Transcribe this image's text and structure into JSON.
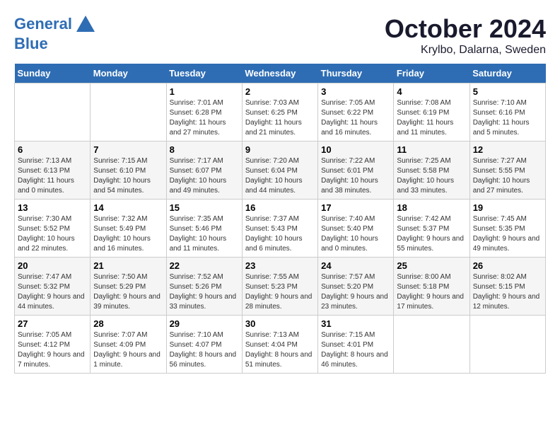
{
  "header": {
    "logo_line1": "General",
    "logo_line2": "Blue",
    "month_title": "October 2024",
    "location": "Krylbo, Dalarna, Sweden"
  },
  "days_of_week": [
    "Sunday",
    "Monday",
    "Tuesday",
    "Wednesday",
    "Thursday",
    "Friday",
    "Saturday"
  ],
  "weeks": [
    [
      {
        "day": "",
        "info": ""
      },
      {
        "day": "",
        "info": ""
      },
      {
        "day": "1",
        "info": "Sunrise: 7:01 AM\nSunset: 6:28 PM\nDaylight: 11 hours and 27 minutes."
      },
      {
        "day": "2",
        "info": "Sunrise: 7:03 AM\nSunset: 6:25 PM\nDaylight: 11 hours and 21 minutes."
      },
      {
        "day": "3",
        "info": "Sunrise: 7:05 AM\nSunset: 6:22 PM\nDaylight: 11 hours and 16 minutes."
      },
      {
        "day": "4",
        "info": "Sunrise: 7:08 AM\nSunset: 6:19 PM\nDaylight: 11 hours and 11 minutes."
      },
      {
        "day": "5",
        "info": "Sunrise: 7:10 AM\nSunset: 6:16 PM\nDaylight: 11 hours and 5 minutes."
      }
    ],
    [
      {
        "day": "6",
        "info": "Sunrise: 7:13 AM\nSunset: 6:13 PM\nDaylight: 11 hours and 0 minutes."
      },
      {
        "day": "7",
        "info": "Sunrise: 7:15 AM\nSunset: 6:10 PM\nDaylight: 10 hours and 54 minutes."
      },
      {
        "day": "8",
        "info": "Sunrise: 7:17 AM\nSunset: 6:07 PM\nDaylight: 10 hours and 49 minutes."
      },
      {
        "day": "9",
        "info": "Sunrise: 7:20 AM\nSunset: 6:04 PM\nDaylight: 10 hours and 44 minutes."
      },
      {
        "day": "10",
        "info": "Sunrise: 7:22 AM\nSunset: 6:01 PM\nDaylight: 10 hours and 38 minutes."
      },
      {
        "day": "11",
        "info": "Sunrise: 7:25 AM\nSunset: 5:58 PM\nDaylight: 10 hours and 33 minutes."
      },
      {
        "day": "12",
        "info": "Sunrise: 7:27 AM\nSunset: 5:55 PM\nDaylight: 10 hours and 27 minutes."
      }
    ],
    [
      {
        "day": "13",
        "info": "Sunrise: 7:30 AM\nSunset: 5:52 PM\nDaylight: 10 hours and 22 minutes."
      },
      {
        "day": "14",
        "info": "Sunrise: 7:32 AM\nSunset: 5:49 PM\nDaylight: 10 hours and 16 minutes."
      },
      {
        "day": "15",
        "info": "Sunrise: 7:35 AM\nSunset: 5:46 PM\nDaylight: 10 hours and 11 minutes."
      },
      {
        "day": "16",
        "info": "Sunrise: 7:37 AM\nSunset: 5:43 PM\nDaylight: 10 hours and 6 minutes."
      },
      {
        "day": "17",
        "info": "Sunrise: 7:40 AM\nSunset: 5:40 PM\nDaylight: 10 hours and 0 minutes."
      },
      {
        "day": "18",
        "info": "Sunrise: 7:42 AM\nSunset: 5:37 PM\nDaylight: 9 hours and 55 minutes."
      },
      {
        "day": "19",
        "info": "Sunrise: 7:45 AM\nSunset: 5:35 PM\nDaylight: 9 hours and 49 minutes."
      }
    ],
    [
      {
        "day": "20",
        "info": "Sunrise: 7:47 AM\nSunset: 5:32 PM\nDaylight: 9 hours and 44 minutes."
      },
      {
        "day": "21",
        "info": "Sunrise: 7:50 AM\nSunset: 5:29 PM\nDaylight: 9 hours and 39 minutes."
      },
      {
        "day": "22",
        "info": "Sunrise: 7:52 AM\nSunset: 5:26 PM\nDaylight: 9 hours and 33 minutes."
      },
      {
        "day": "23",
        "info": "Sunrise: 7:55 AM\nSunset: 5:23 PM\nDaylight: 9 hours and 28 minutes."
      },
      {
        "day": "24",
        "info": "Sunrise: 7:57 AM\nSunset: 5:20 PM\nDaylight: 9 hours and 23 minutes."
      },
      {
        "day": "25",
        "info": "Sunrise: 8:00 AM\nSunset: 5:18 PM\nDaylight: 9 hours and 17 minutes."
      },
      {
        "day": "26",
        "info": "Sunrise: 8:02 AM\nSunset: 5:15 PM\nDaylight: 9 hours and 12 minutes."
      }
    ],
    [
      {
        "day": "27",
        "info": "Sunrise: 7:05 AM\nSunset: 4:12 PM\nDaylight: 9 hours and 7 minutes."
      },
      {
        "day": "28",
        "info": "Sunrise: 7:07 AM\nSunset: 4:09 PM\nDaylight: 9 hours and 1 minute."
      },
      {
        "day": "29",
        "info": "Sunrise: 7:10 AM\nSunset: 4:07 PM\nDaylight: 8 hours and 56 minutes."
      },
      {
        "day": "30",
        "info": "Sunrise: 7:13 AM\nSunset: 4:04 PM\nDaylight: 8 hours and 51 minutes."
      },
      {
        "day": "31",
        "info": "Sunrise: 7:15 AM\nSunset: 4:01 PM\nDaylight: 8 hours and 46 minutes."
      },
      {
        "day": "",
        "info": ""
      },
      {
        "day": "",
        "info": ""
      }
    ]
  ]
}
